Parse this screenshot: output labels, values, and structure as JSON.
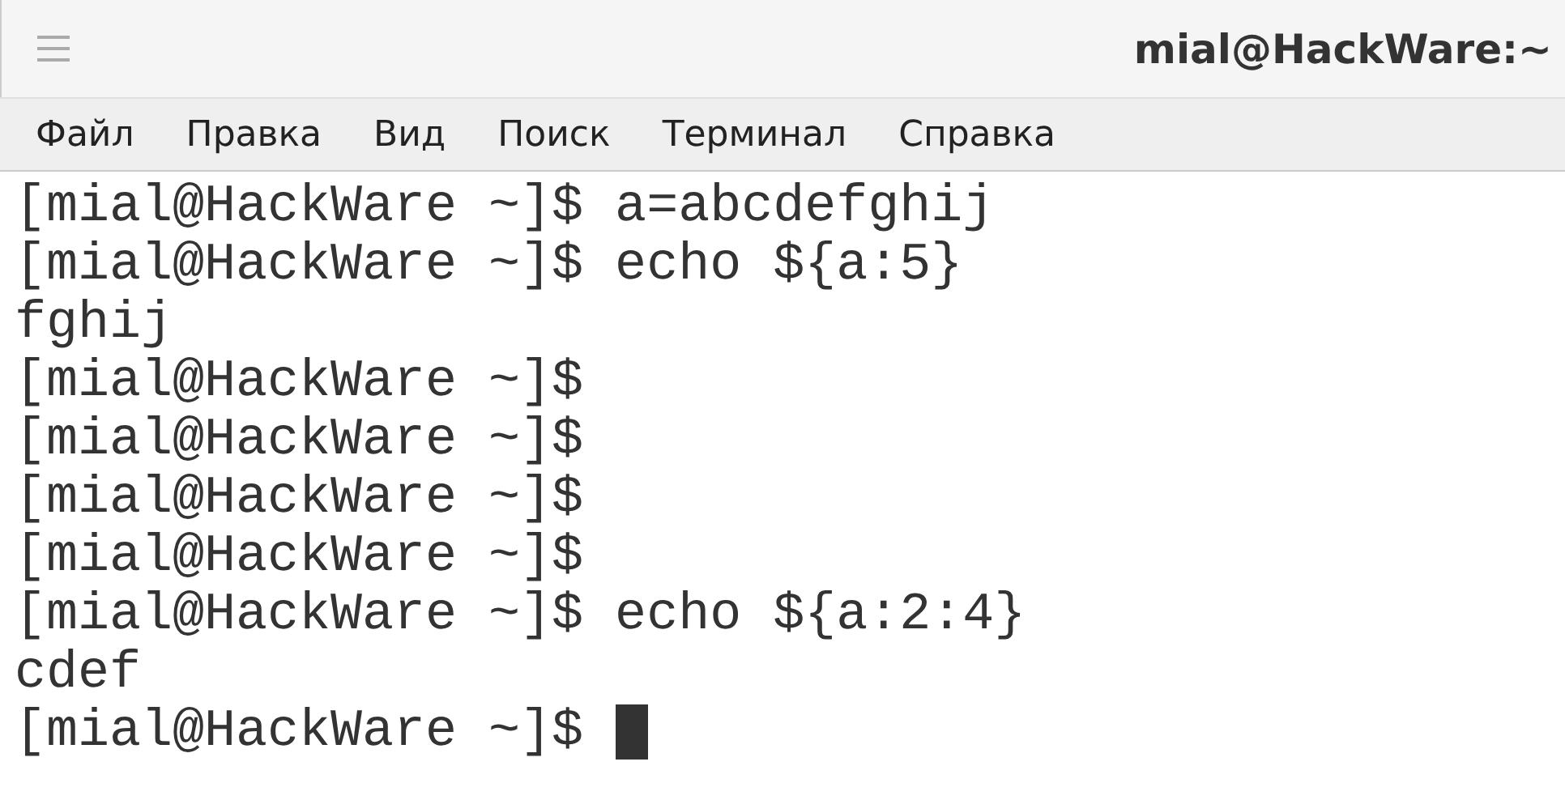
{
  "window": {
    "title": "mial@HackWare:~"
  },
  "menu": [
    "Файл",
    "Правка",
    "Вид",
    "Поиск",
    "Терминал",
    "Справка"
  ],
  "terminal": {
    "lines": [
      "[mial@HackWare ~]$ a=abcdefghij",
      "[mial@HackWare ~]$ echo ${a:5}",
      "fghij",
      "[mial@HackWare ~]$",
      "[mial@HackWare ~]$",
      "[mial@HackWare ~]$",
      "[mial@HackWare ~]$",
      "[mial@HackWare ~]$ echo ${a:2:4}",
      "cdef",
      "[mial@HackWare ~]$"
    ],
    "cursor_visible": true
  }
}
